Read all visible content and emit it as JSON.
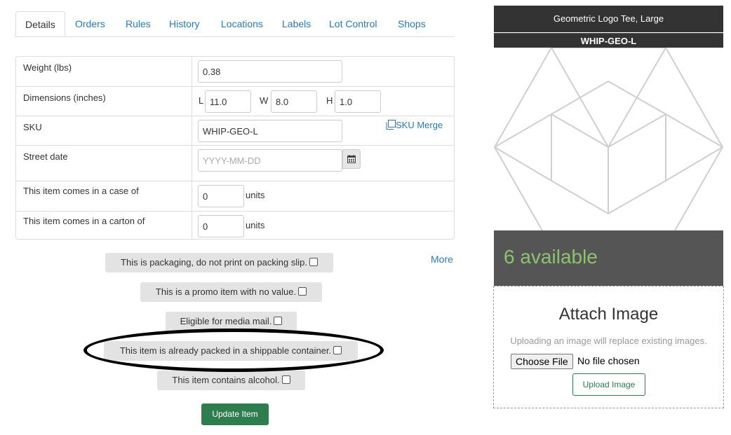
{
  "tabs": [
    "Details",
    "Orders",
    "Rules",
    "History",
    "Locations",
    "Labels",
    "Lot Control",
    "Shops"
  ],
  "details": {
    "weight_label": "Weight (lbs)",
    "weight_value": "0.38",
    "dimensions_label": "Dimensions (inches)",
    "dim_l_tag": "L",
    "dim_l_value": "11.0",
    "dim_w_tag": "W",
    "dim_w_value": "8.0",
    "dim_h_tag": "H",
    "dim_h_value": "1.0",
    "sku_label": "SKU",
    "sku_value": "WHIP-GEO-L",
    "sku_merge_label": "SKU Merge",
    "street_date_label": "Street date",
    "street_date_placeholder": "YYYY-MM-DD",
    "case_label": "This item comes in a case of",
    "case_value": "0",
    "case_units": "units",
    "carton_label": "This item comes in a carton of",
    "carton_value": "0",
    "carton_units": "units"
  },
  "more_label": "More",
  "checks": {
    "packaging": "This is packaging, do not print on packing slip.",
    "promo": "This is a promo item with no value.",
    "media_mail": "Eligible for media mail.",
    "packed": "This item is already packed in a shippable container.",
    "alcohol": "This item contains alcohol."
  },
  "update_button": "Update Item",
  "product": {
    "title": "Geometric Logo Tee, Large",
    "sku": "WHIP-GEO-L",
    "available": "6 available"
  },
  "attach": {
    "title": "Attach Image",
    "note": "Uploading an image will replace existing images.",
    "choose_file": "Choose File",
    "file_status": "No file chosen",
    "upload_button": "Upload Image"
  },
  "icons": {
    "calendar": "calendar-icon",
    "sku_merge": "copy-icon"
  }
}
